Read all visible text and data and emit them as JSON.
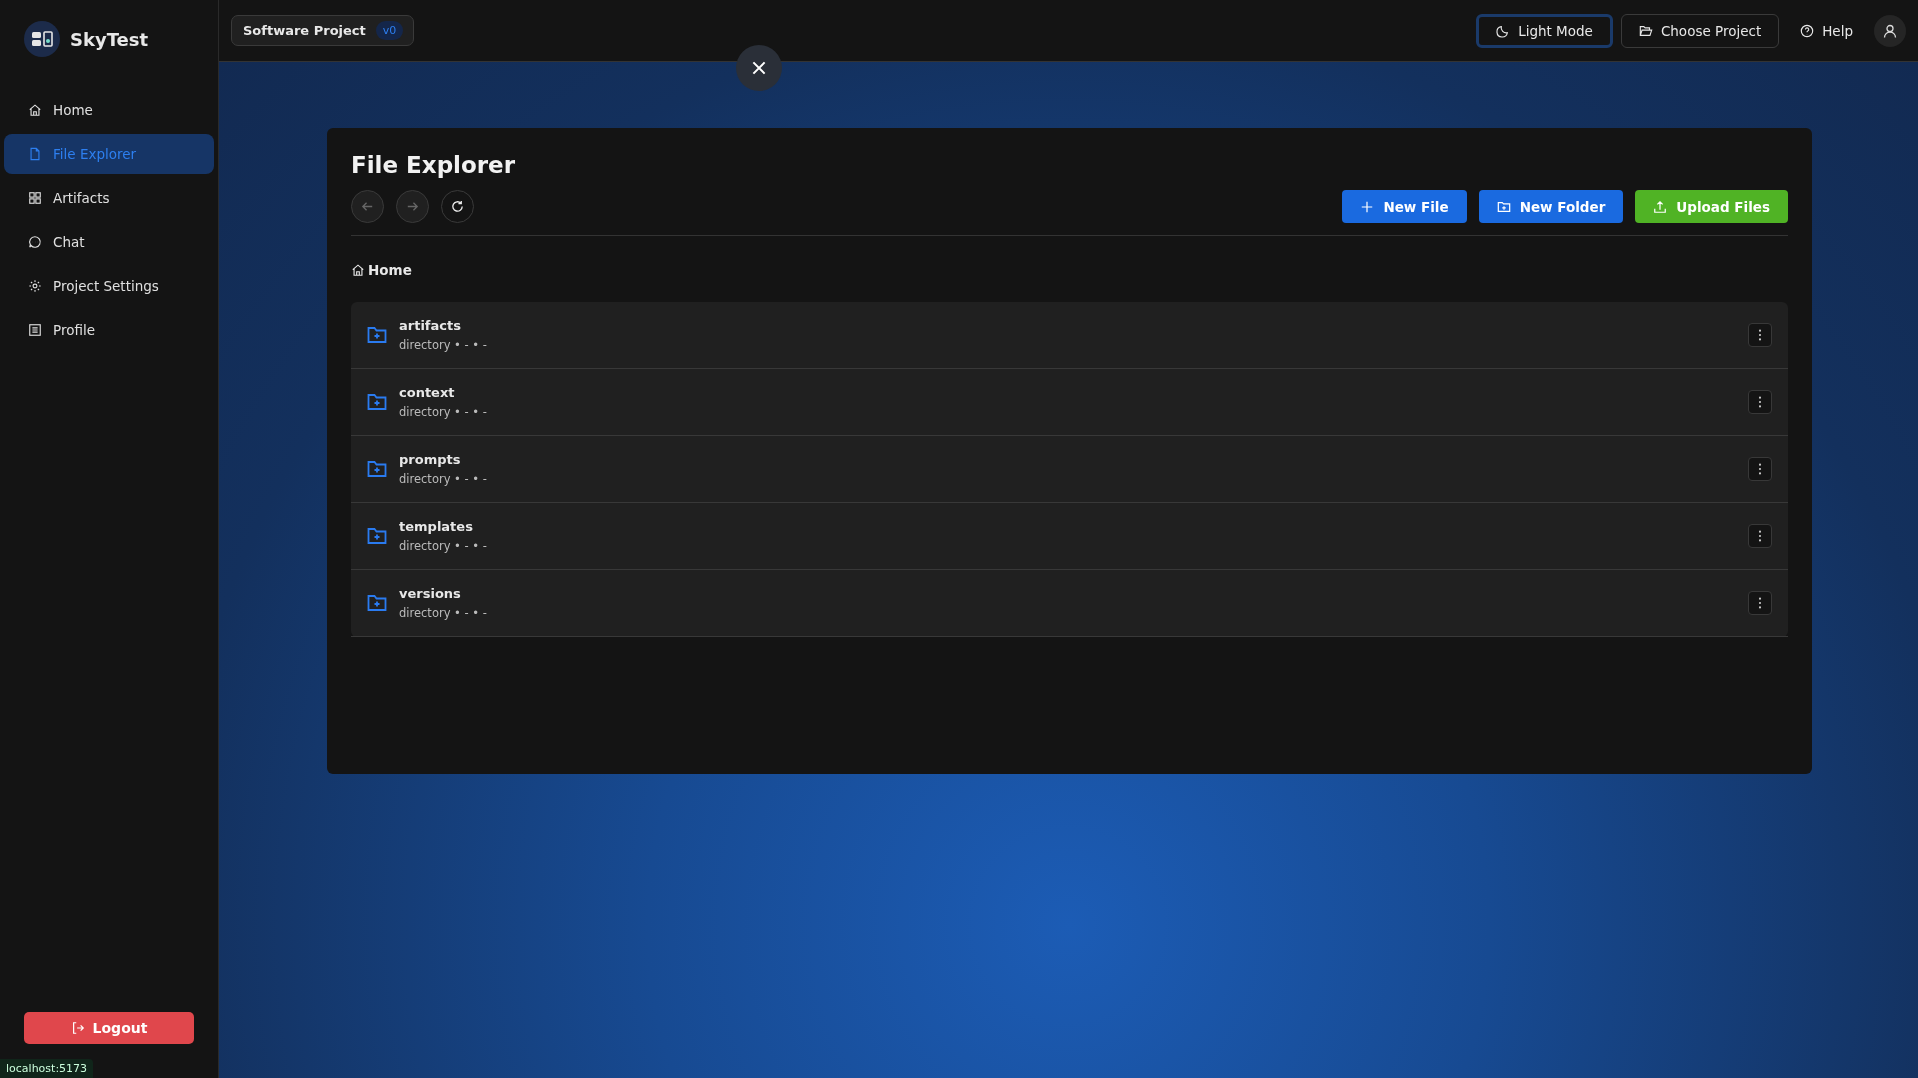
{
  "app": {
    "name": "SkyTest"
  },
  "sidebar": {
    "items": [
      {
        "label": "Home",
        "kind": "home",
        "selected": false
      },
      {
        "label": "File Explorer",
        "kind": "file",
        "selected": true
      },
      {
        "label": "Artifacts",
        "kind": "grid",
        "selected": false
      },
      {
        "label": "Chat",
        "kind": "chat",
        "selected": false
      },
      {
        "label": "Project Settings",
        "kind": "gear",
        "selected": false
      },
      {
        "label": "Profile",
        "kind": "profile",
        "selected": false
      }
    ],
    "logout": "Logout"
  },
  "topbar": {
    "project": "Software Project",
    "version": "v0",
    "buttons": [
      {
        "label": "Light Mode",
        "kind": "moon",
        "selected": true
      },
      {
        "label": "Choose Project",
        "kind": "folder",
        "selected": false
      },
      {
        "label": "Help",
        "kind": "help",
        "selected": false
      }
    ]
  },
  "explorer": {
    "title": "File Explorer",
    "nav": [
      {
        "kind": "back",
        "disabled": true
      },
      {
        "kind": "forward",
        "disabled": true
      },
      {
        "kind": "refresh",
        "disabled": false
      }
    ],
    "actions": [
      {
        "label": "New File",
        "kind": "plus"
      },
      {
        "label": "New Folder",
        "kind": "folder"
      },
      {
        "label": "Upload Files",
        "kind": "upload"
      }
    ],
    "breadcrumb": "Home",
    "entries": [
      {
        "name": "artifacts",
        "meta": "directory • - • -"
      },
      {
        "name": "context",
        "meta": "directory • - • -"
      },
      {
        "name": "prompts",
        "meta": "directory • - • -"
      },
      {
        "name": "templates",
        "meta": "directory • - • -"
      },
      {
        "name": "versions",
        "meta": "directory • - • -"
      }
    ]
  },
  "status_bar": "localhost:5173"
}
